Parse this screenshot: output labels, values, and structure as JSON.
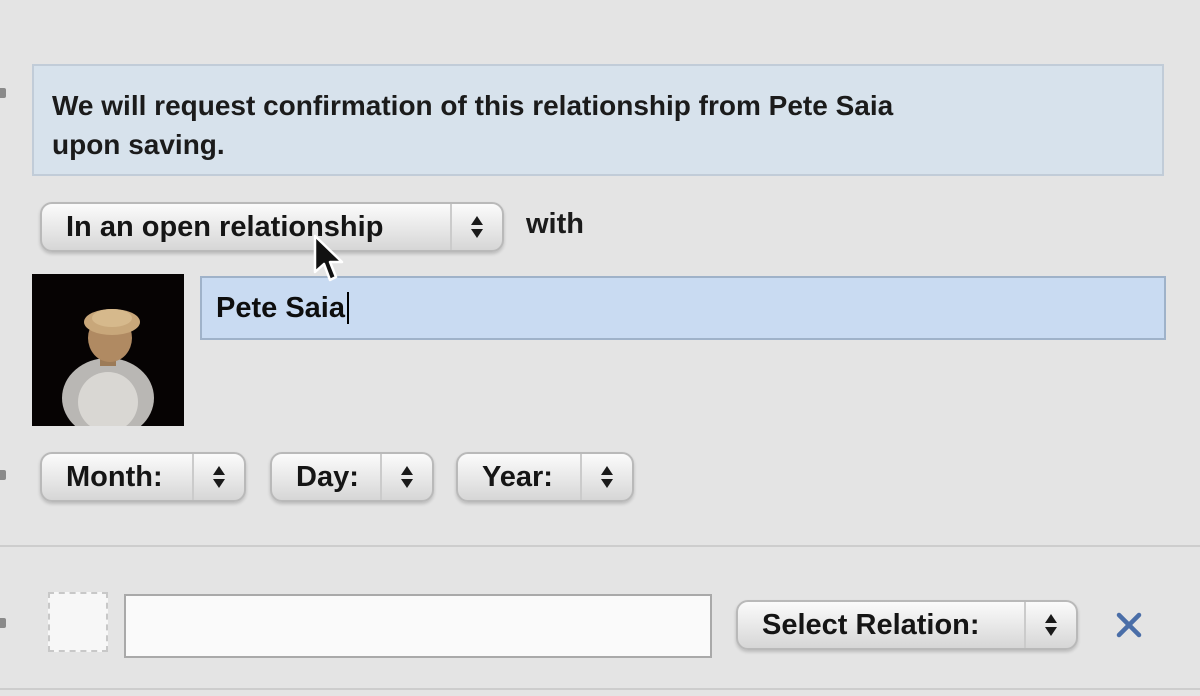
{
  "notice": {
    "line1": "We will request confirmation of this relationship from Pete Saia",
    "line2": "upon saving."
  },
  "relationship": {
    "status_selected": "In an open relationship",
    "with_label": "with",
    "partner_name": "Pete Saia"
  },
  "date": {
    "month_label": "Month:",
    "day_label": "Day:",
    "year_label": "Year:"
  },
  "family": {
    "relation_input_value": "",
    "relation_select_label": "Select Relation:"
  },
  "colors": {
    "notice_background": "#d7e2ec",
    "focused_input_background": "#c9dbf2",
    "remove_icon": "#4a6ea8"
  },
  "icons": {
    "stepper": "up-down-arrows-icon",
    "remove": "close-icon",
    "cursor": "mouse-pointer-icon"
  }
}
